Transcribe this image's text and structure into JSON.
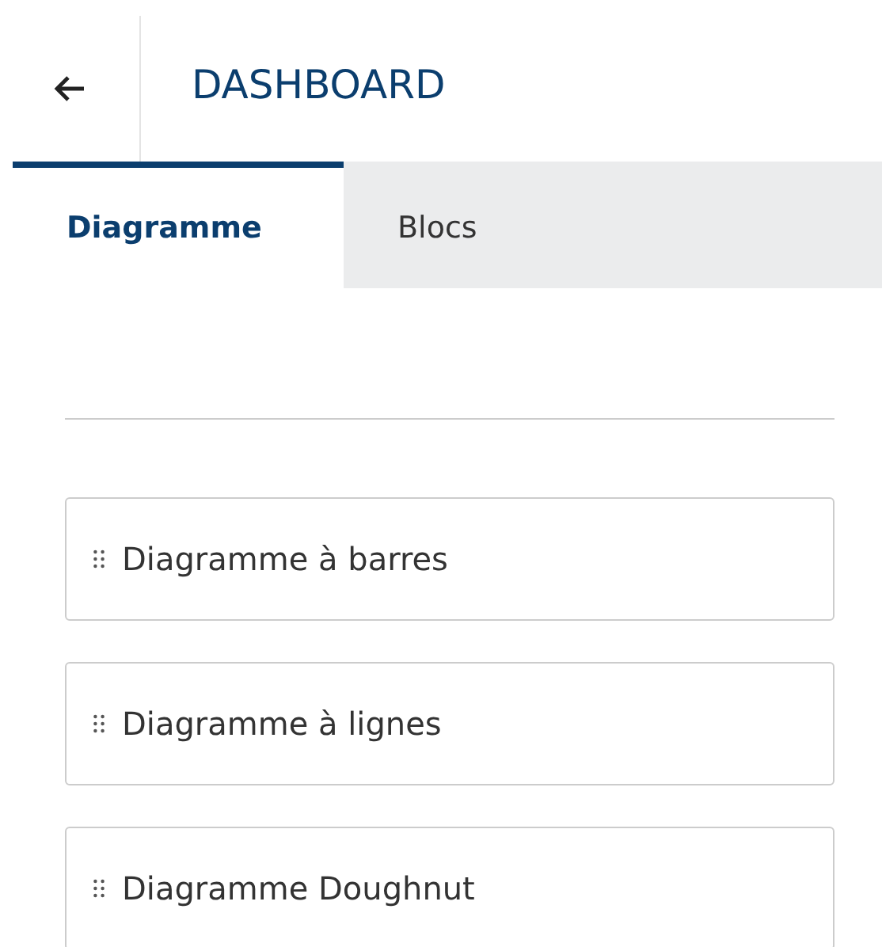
{
  "header": {
    "title": "DASHBOARD"
  },
  "tabs": [
    {
      "label": "Diagramme",
      "selected": true
    },
    {
      "label": "Blocs",
      "selected": false
    }
  ],
  "items": [
    {
      "label": "Diagramme à barres"
    },
    {
      "label": "Diagramme à lignes"
    },
    {
      "label": "Diagramme Doughnut"
    }
  ]
}
